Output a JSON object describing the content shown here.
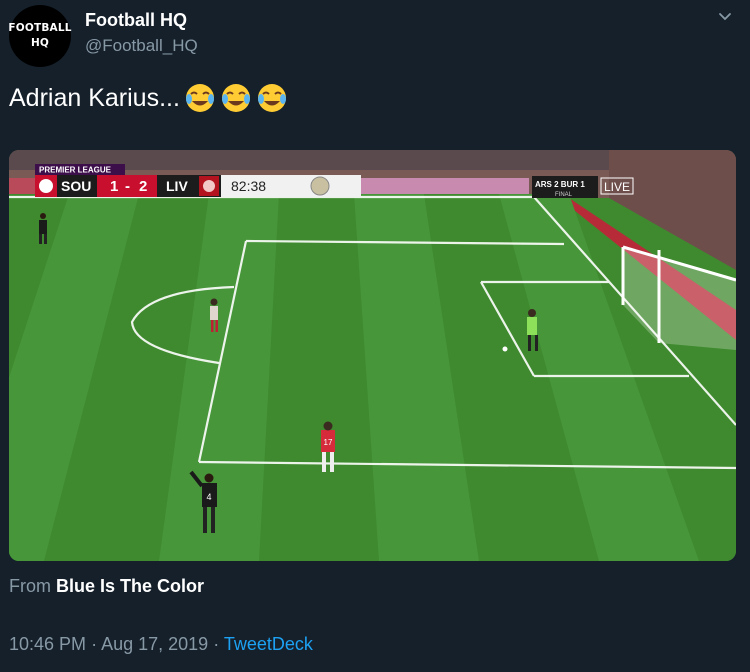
{
  "tweet": {
    "avatar_text_line1": "FOOTBALL",
    "avatar_text_line2": "HQ",
    "display_name": "Football HQ",
    "handle": "@Football_HQ",
    "text": "Adrian Karius...",
    "emoji_icon": "face-with-tears-of-joy-icon",
    "emoji_count": 3
  },
  "video": {
    "league": "PREMIER LEAGUE",
    "home_team": "SOU",
    "home_score": "1",
    "score_sep": "-",
    "away_score": "2",
    "away_team": "LIV",
    "clock": "82:38",
    "other_match": "ARS  2  BUR  1",
    "other_status": "FINAL",
    "live_label": "LIVE",
    "player_number_17": "17",
    "player_number_4": "4"
  },
  "attribution": {
    "prefix": "From",
    "source": "Blue Is The Color"
  },
  "meta": {
    "time": "10:46 PM",
    "sep1": "·",
    "date": "Aug 17, 2019",
    "sep2": "·",
    "client": "TweetDeck"
  },
  "colors": {
    "background": "#15202b",
    "secondary_text": "#8899a6",
    "link": "#1da1f2",
    "pitch_green": "#3f8a2e",
    "southampton_red": "#c8102e"
  }
}
